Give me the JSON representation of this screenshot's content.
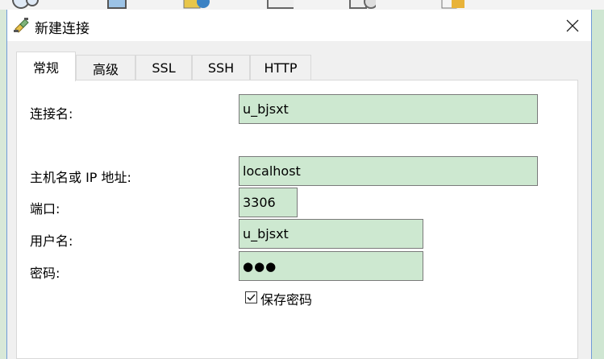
{
  "window": {
    "title": "新建连接"
  },
  "tabs": [
    {
      "label": "常规"
    },
    {
      "label": "高级"
    },
    {
      "label": "SSL"
    },
    {
      "label": "SSH"
    },
    {
      "label": "HTTP"
    }
  ],
  "form": {
    "connection_name_label": "连接名:",
    "connection_name_value": "u_bjsxt",
    "host_label": "主机名或 IP 地址:",
    "host_value": "localhost",
    "port_label": "端口:",
    "port_value": "3306",
    "username_label": "用户名:",
    "username_value": "u_bjsxt",
    "password_label": "密码:",
    "password_value": "●●●",
    "save_password_label": "保存密码",
    "save_password_checked": true
  },
  "colors": {
    "field_bg": "#cde8d0",
    "window_border": "#6f9bd8"
  }
}
